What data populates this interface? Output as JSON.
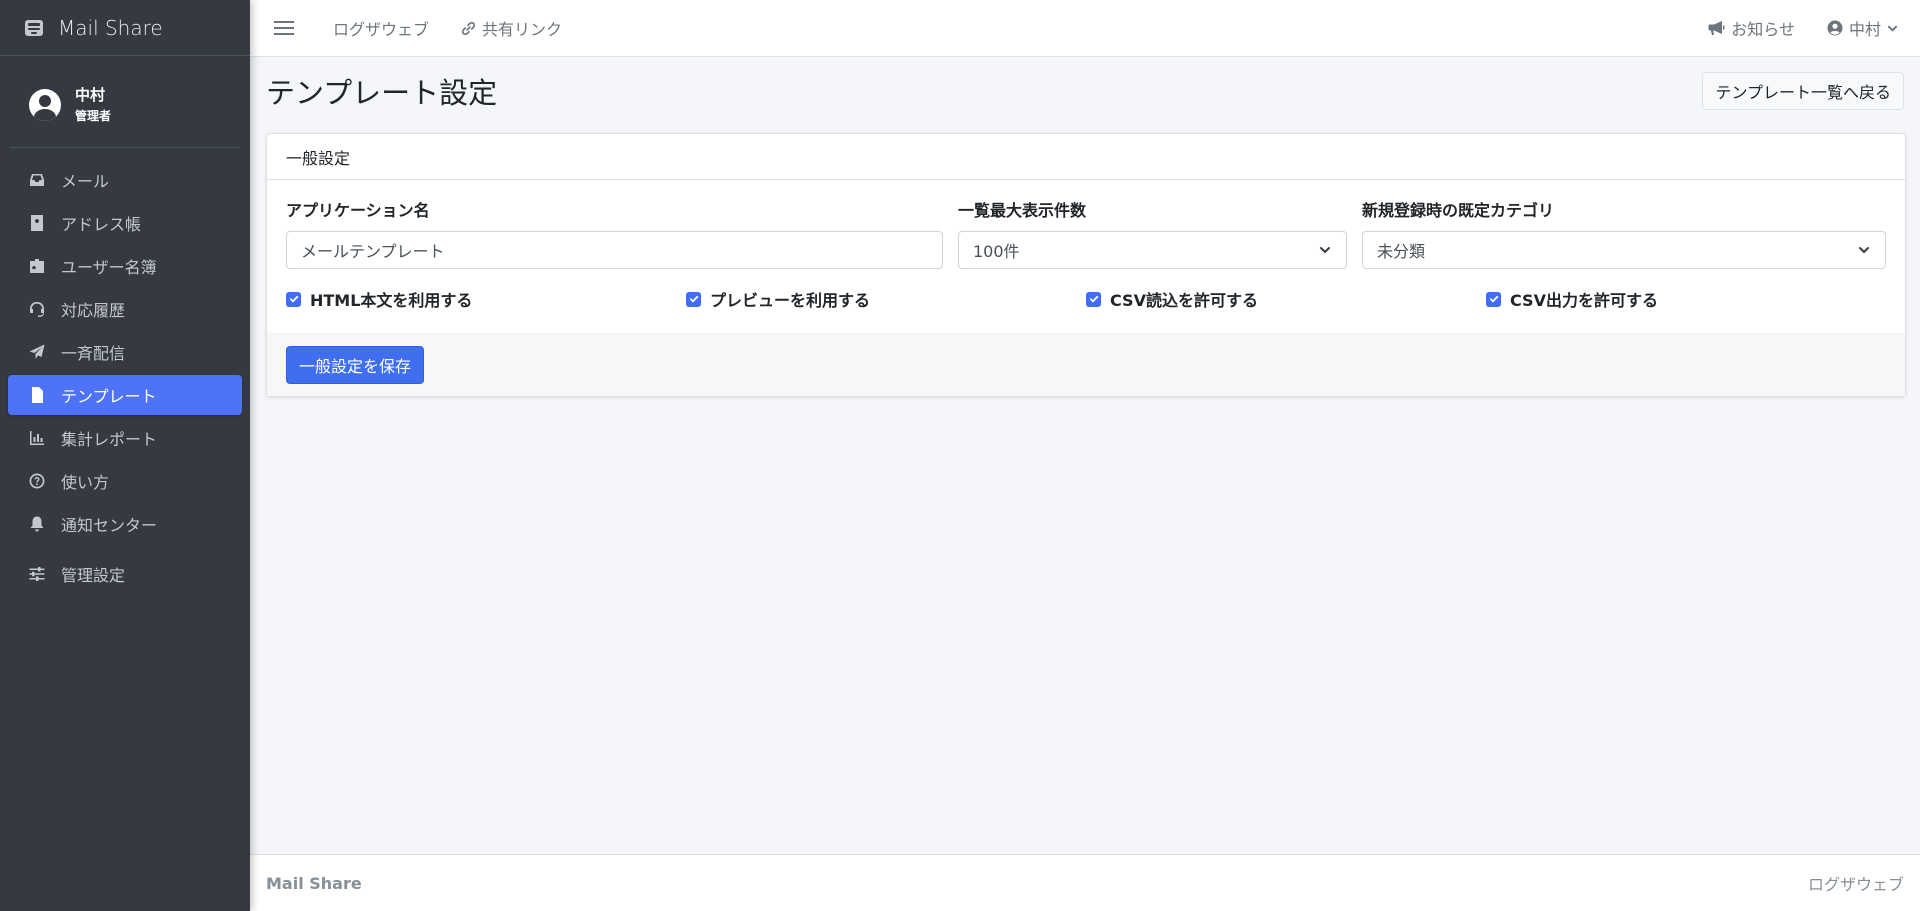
{
  "brand": {
    "name": "Mail Share",
    "icon": "mail-box-icon"
  },
  "user": {
    "name": "中村",
    "role": "管理者"
  },
  "sidebar": {
    "items": [
      {
        "label": "メール",
        "icon": "inbox-icon"
      },
      {
        "label": "アドレス帳",
        "icon": "address-book-icon"
      },
      {
        "label": "ユーザー名簿",
        "icon": "id-badge-icon"
      },
      {
        "label": "対応履歴",
        "icon": "headset-icon"
      },
      {
        "label": "一斉配信",
        "icon": "paper-plane-icon"
      },
      {
        "label": "テンプレート",
        "icon": "file-icon",
        "active": true
      },
      {
        "label": "集計レポート",
        "icon": "chart-bar-icon"
      },
      {
        "label": "使い方",
        "icon": "question-circle-icon"
      },
      {
        "label": "通知センター",
        "icon": "bell-icon"
      },
      {
        "label": "管理設定",
        "icon": "sliders-icon"
      }
    ]
  },
  "topbar": {
    "link1": "ログザウェブ",
    "link2": "共有リンク",
    "notice": "お知らせ",
    "user": "中村"
  },
  "page": {
    "title": "テンプレート設定",
    "back_button": "テンプレート一覧へ戻る"
  },
  "card": {
    "header": "一般設定",
    "fields": {
      "app_name_label": "アプリケーション名",
      "app_name_value": "メールテンプレート",
      "max_display_label": "一覧最大表示件数",
      "max_display_value": "100件",
      "default_category_label": "新規登録時の既定カテゴリ",
      "default_category_value": "未分類"
    },
    "checks": [
      {
        "label": "HTML本文を利用する",
        "checked": true
      },
      {
        "label": "プレビューを利用する",
        "checked": true
      },
      {
        "label": "CSV読込を許可する",
        "checked": true
      },
      {
        "label": "CSV出力を許可する",
        "checked": true
      }
    ],
    "save_button": "一般設定を保存"
  },
  "footer": {
    "brand": "Mail Share",
    "right": "ログザウェブ"
  },
  "colors": {
    "sidebar_bg": "#343a40",
    "accent": "#4e73f7",
    "content_bg": "#f4f6f9"
  }
}
